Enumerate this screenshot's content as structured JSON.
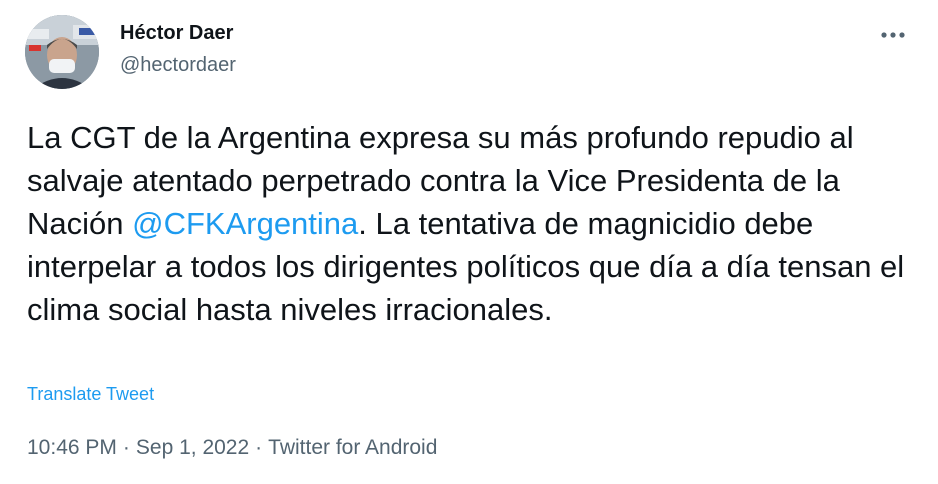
{
  "author": {
    "display_name": "Héctor Daer",
    "handle": "@hectordaer"
  },
  "tweet": {
    "text_before": "La CGT de la Argentina expresa su más profundo repudio al salvaje atentado perpetrado contra la Vice Presidenta de la Nación ",
    "mention": "@CFKArgentina",
    "text_after": ". La tentativa de magnicidio debe interpelar a todos los dirigentes políticos que día a día tensan el clima social hasta niveles irracionales."
  },
  "translate_label": "Translate Tweet",
  "meta": {
    "time": "10:46 PM",
    "date": "Sep 1, 2022",
    "source": "Twitter for Android",
    "separator": "·"
  },
  "icons": {
    "more": "more-horizontal-icon",
    "avatar": "profile-photo"
  },
  "colors": {
    "link": "#1d9bf0",
    "text": "#0f1419",
    "secondary": "#536471"
  }
}
